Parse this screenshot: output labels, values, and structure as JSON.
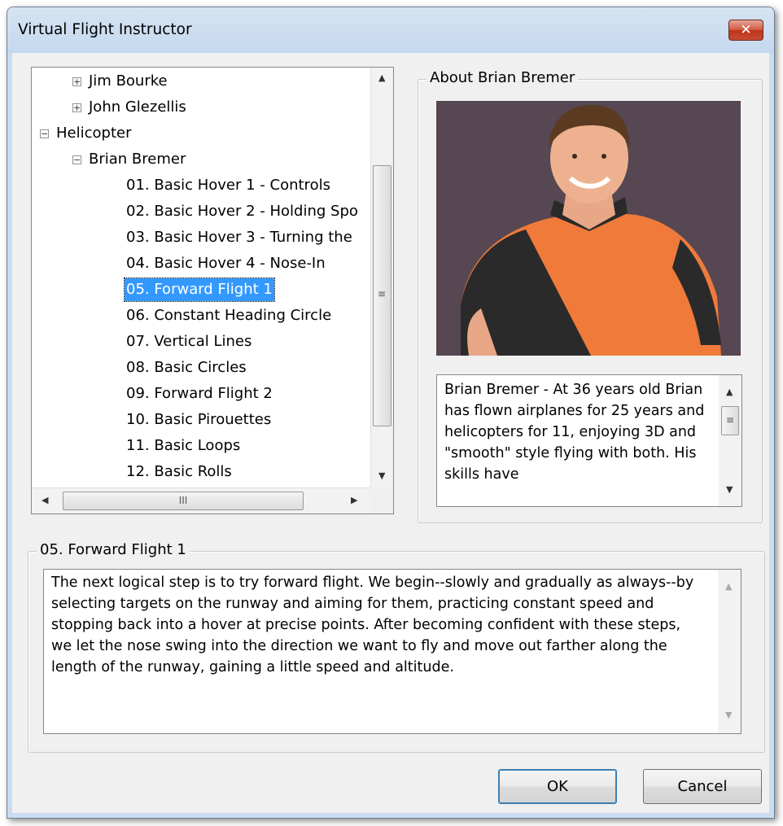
{
  "window": {
    "title": "Virtual Flight Instructor",
    "close_label": "✕"
  },
  "tree": {
    "nodes": [
      {
        "label": "Jim Bourke",
        "expander": "+"
      },
      {
        "label": "John Glezellis",
        "expander": "+"
      },
      {
        "label": "Helicopter",
        "expander": "−"
      },
      {
        "label": "Brian Bremer",
        "expander": "−"
      },
      {
        "label": "01. Basic Hover 1 - Controls"
      },
      {
        "label": "02. Basic Hover 2 - Holding Spo"
      },
      {
        "label": "03. Basic Hover 3 - Turning the"
      },
      {
        "label": "04. Basic Hover 4 - Nose-In"
      },
      {
        "label": "05. Forward Flight 1",
        "selected": true
      },
      {
        "label": "06. Constant Heading Circle"
      },
      {
        "label": "07. Vertical Lines"
      },
      {
        "label": "08. Basic Circles"
      },
      {
        "label": "09. Forward Flight 2"
      },
      {
        "label": "10. Basic Pirouettes"
      },
      {
        "label": "11. Basic Loops"
      },
      {
        "label": "12. Basic Rolls"
      }
    ],
    "hscroll_grip": "III"
  },
  "about": {
    "label": "About Brian Bremer",
    "bio": "Brian Bremer - At 36 years old Brian has flown airplanes for 25 years and helicopters for 11, enjoying 3D and \"smooth\" style flying with both. His skills have"
  },
  "lesson": {
    "label": "05. Forward Flight 1",
    "description": "The next logical step is to try forward flight. We begin--slowly and gradually as always--by selecting targets on the runway and aiming for them, practicing constant speed and stopping back into a hover at precise points. After becoming confident with these steps, we let the nose swing into the direction we want to fly and move out farther along the length of the runway, gaining a little speed and altitude."
  },
  "buttons": {
    "ok": "OK",
    "cancel": "Cancel"
  }
}
